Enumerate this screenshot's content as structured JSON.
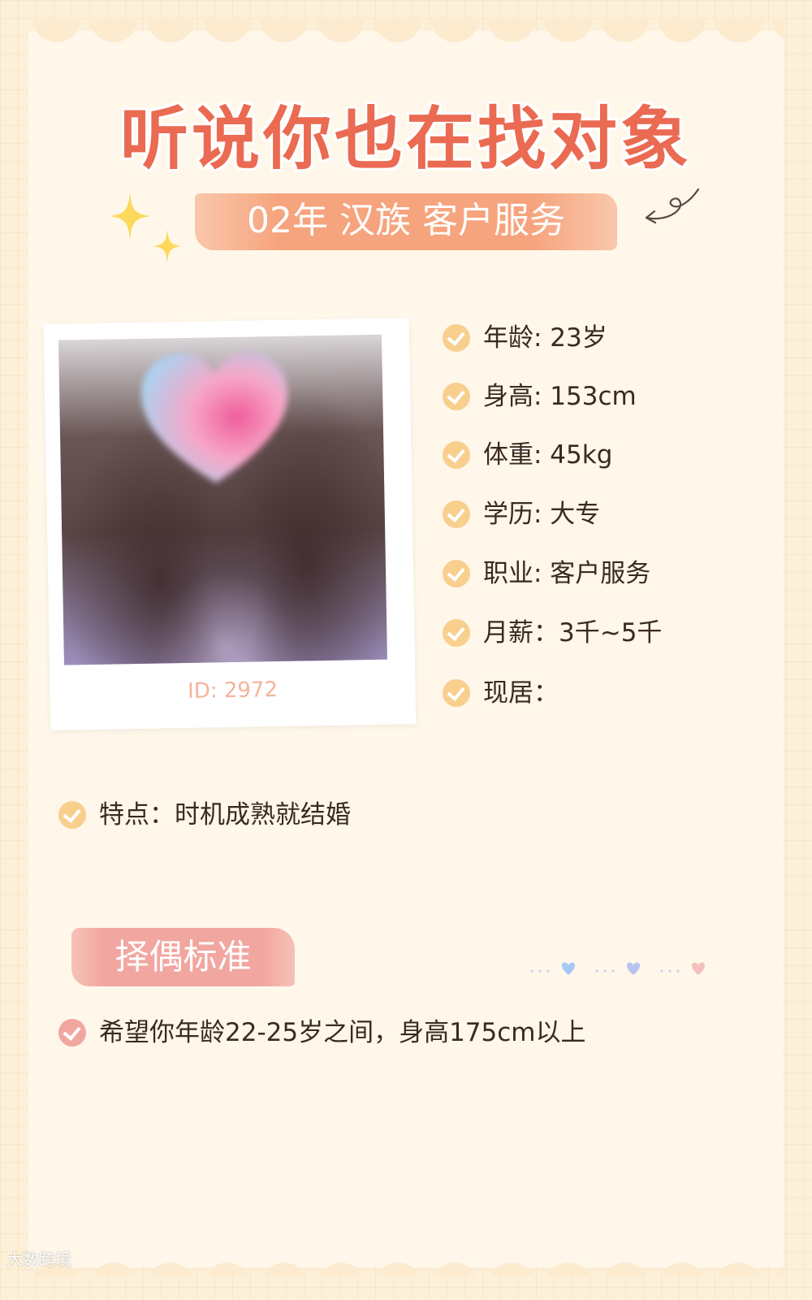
{
  "header": {
    "title": "听说你也在找对象",
    "subtitle": "02年  汉族 客户服务"
  },
  "profile": {
    "photo_id": "ID: 2972",
    "info": [
      {
        "label": "年龄: 23岁"
      },
      {
        "label": "身高: 153cm"
      },
      {
        "label": "体重: 45kg"
      },
      {
        "label": "学历: 大专"
      },
      {
        "label": "职业: 客户服务"
      },
      {
        "label": "月薪：3千~5千"
      },
      {
        "label": "现居："
      }
    ],
    "feature": "特点：时机成熟就结婚"
  },
  "criteria_section": {
    "title": "择偶标准",
    "items": [
      "希望你年龄22-25岁之间，身高175cm以上"
    ]
  },
  "watermark": "大数跨境",
  "colors": {
    "title": "#ea6a52",
    "subtitle_bg": "#f6a47d",
    "check_yellow": "#f9cf8e",
    "check_pink": "#f2a6a0",
    "text": "#3b2a1f",
    "card_bg": "#fef7ea"
  },
  "icons": {
    "check": "check-circle-icon",
    "sparkle": "sparkle-icon",
    "arrow": "curly-arrow-icon",
    "heart": "heart-icon"
  }
}
